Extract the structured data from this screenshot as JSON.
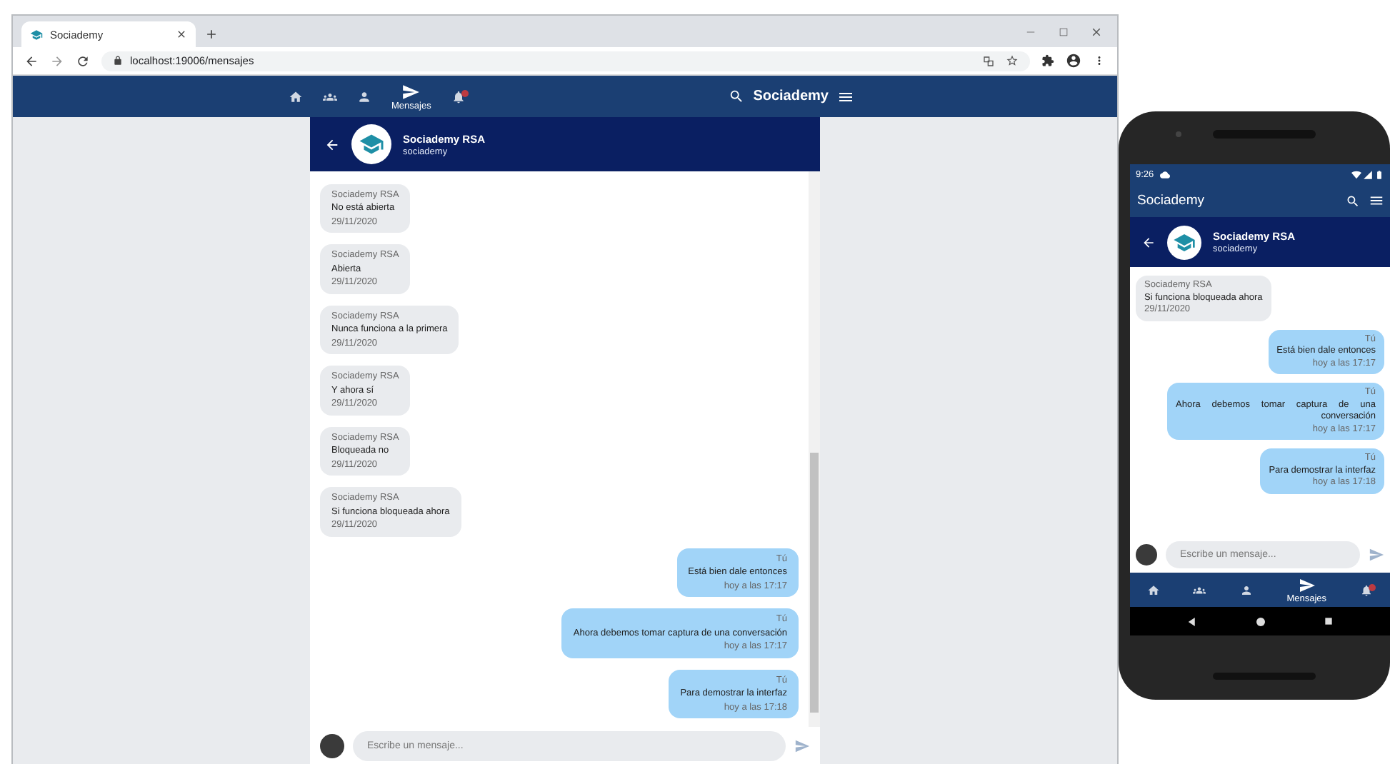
{
  "browser": {
    "tab": {
      "title": "Sociademy"
    },
    "address": "localhost:19006/mensajes",
    "nav": [
      {
        "kind": "home",
        "selected": false,
        "unread": false
      },
      {
        "kind": "groups",
        "selected": false,
        "unread": false
      },
      {
        "kind": "profile",
        "selected": false,
        "unread": false
      },
      {
        "kind": "messages",
        "label": "Mensajes",
        "selected": true,
        "unread": false
      },
      {
        "kind": "notifications",
        "selected": false,
        "unread": true
      }
    ],
    "brand": "Sociademy",
    "chat": {
      "name": "Sociademy RSA",
      "handle": "sociademy"
    },
    "messages": [
      {
        "kind": "received",
        "sender": "Sociademy RSA",
        "text": "No está abierta",
        "time": "29/11/2020"
      },
      {
        "kind": "received",
        "sender": "Sociademy RSA",
        "text": "Abierta",
        "time": "29/11/2020"
      },
      {
        "kind": "received",
        "sender": "Sociademy RSA",
        "text": "Nunca funciona a la primera",
        "time": "29/11/2020"
      },
      {
        "kind": "received",
        "sender": "Sociademy RSA",
        "text": "Y ahora sí",
        "time": "29/11/2020"
      },
      {
        "kind": "received",
        "sender": "Sociademy RSA",
        "text": "Bloqueada no",
        "time": "29/11/2020"
      },
      {
        "kind": "received",
        "sender": "Sociademy RSA",
        "text": "Si funciona bloqueada ahora",
        "time": "29/11/2020"
      },
      {
        "kind": "sent",
        "sender": "Tú",
        "text": "Está bien dale entonces",
        "time": "hoy a las 17:17"
      },
      {
        "kind": "sent",
        "sender": "Tú",
        "text": "Ahora debemos tomar captura de una conversación",
        "time": "hoy a las 17:17"
      },
      {
        "kind": "sent",
        "sender": "Tú",
        "text": "Para demostrar la interfaz",
        "time": "hoy a las 17:18"
      }
    ],
    "input": {
      "placeholder": "Escribe un mensaje..."
    }
  },
  "phone": {
    "status_time": "9:26",
    "title": "Sociademy",
    "chat": {
      "name": "Sociademy RSA",
      "handle": "sociademy"
    },
    "messages": [
      {
        "kind": "received",
        "sender": "Sociademy RSA",
        "text": "Si funciona bloqueada ahora",
        "time": "29/11/2020"
      },
      {
        "kind": "sent",
        "sender": "Tú",
        "text": "Está bien dale entonces",
        "time": "hoy a las 17:17"
      },
      {
        "kind": "sent",
        "sender": "Tú",
        "text": "Ahora debemos tomar captura de una conversación",
        "time": "hoy a las 17:17"
      },
      {
        "kind": "sent",
        "sender": "Tú",
        "text": "Para demostrar la interfaz",
        "time": "hoy a las 17:18"
      }
    ],
    "input": {
      "placeholder": "Escribe un mensaje..."
    },
    "nav": [
      {
        "kind": "home",
        "selected": false,
        "unread": false
      },
      {
        "kind": "groups",
        "selected": false,
        "unread": false
      },
      {
        "kind": "profile",
        "selected": false,
        "unread": false
      },
      {
        "kind": "messages",
        "label": "Mensajes",
        "selected": true,
        "unread": false
      },
      {
        "kind": "notifications",
        "selected": false,
        "unread": true
      }
    ]
  }
}
